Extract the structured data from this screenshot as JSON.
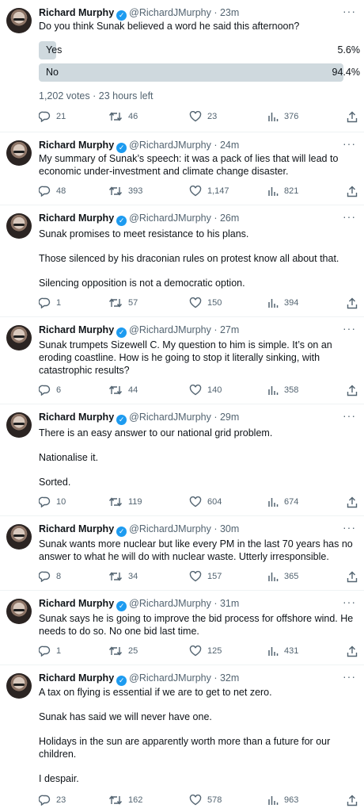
{
  "tweets": [
    {
      "name": "Richard Murphy",
      "handle": "@RichardJMurphy",
      "time": "23m",
      "text": [
        "Do you think Sunak believed a word he said this afternoon?"
      ],
      "poll": {
        "options": [
          {
            "label": "Yes",
            "pct": "5.6%",
            "value": 5.6
          },
          {
            "label": "No",
            "pct": "94.4%",
            "value": 94.4
          }
        ],
        "meta": "1,202 votes · 23 hours left"
      },
      "replies": "21",
      "retweets": "46",
      "likes": "23",
      "views": "376"
    },
    {
      "name": "Richard Murphy",
      "handle": "@RichardJMurphy",
      "time": "24m",
      "text": [
        "My summary of Sunak’s speech: it was a pack of lies that will lead to economic under-investment and climate change disaster."
      ],
      "replies": "48",
      "retweets": "393",
      "likes": "1,147",
      "views": "821"
    },
    {
      "name": "Richard Murphy",
      "handle": "@RichardJMurphy",
      "time": "26m",
      "text": [
        "Sunak promises to meet resistance to his plans.",
        "Those silenced by his draconian rules on protest know all about that.",
        "Silencing opposition is not a democratic option."
      ],
      "replies": "1",
      "retweets": "57",
      "likes": "150",
      "views": "394"
    },
    {
      "name": "Richard Murphy",
      "handle": "@RichardJMurphy",
      "time": "27m",
      "text": [
        "Sunak trumpets Sizewell C. My question to him is simple. It’s on an eroding coastline. How is he going to stop it literally sinking, with catastrophic results?"
      ],
      "replies": "6",
      "retweets": "44",
      "likes": "140",
      "views": "358"
    },
    {
      "name": "Richard Murphy",
      "handle": "@RichardJMurphy",
      "time": "29m",
      "text": [
        "There is an easy answer to our national grid problem.",
        "Nationalise it.",
        "Sorted."
      ],
      "replies": "10",
      "retweets": "119",
      "likes": "604",
      "views": "674"
    },
    {
      "name": "Richard Murphy",
      "handle": "@RichardJMurphy",
      "time": "30m",
      "text": [
        "Sunak wants more nuclear but like every PM in the last 70 years has no answer to what he will do with nuclear waste. Utterly irresponsible."
      ],
      "replies": "8",
      "retweets": "34",
      "likes": "157",
      "views": "365"
    },
    {
      "name": "Richard Murphy",
      "handle": "@RichardJMurphy",
      "time": "31m",
      "text": [
        "Sunak says he is going to improve the bid process for offshore wind. He needs to do so. No one bid last time."
      ],
      "replies": "1",
      "retweets": "25",
      "likes": "125",
      "views": "431"
    },
    {
      "name": "Richard Murphy",
      "handle": "@RichardJMurphy",
      "time": "32m",
      "text": [
        "A tax on flying is essential if we are to get to net zero.",
        "Sunak has said we will never have one.",
        "Holidays in the sun are apparently worth more than a future for our children.",
        "I despair."
      ],
      "replies": "23",
      "retweets": "162",
      "likes": "578",
      "views": "963"
    }
  ]
}
